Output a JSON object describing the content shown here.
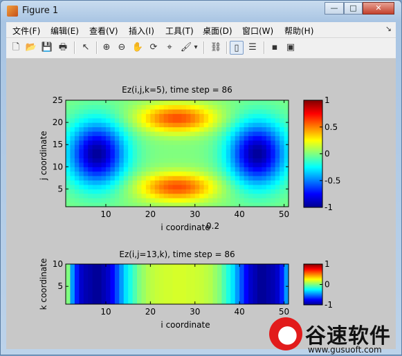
{
  "window": {
    "title": "Figure 1",
    "controls": {
      "minimize": "—",
      "maximize": "□",
      "close": "✕"
    }
  },
  "menu": {
    "items": [
      "文件(F)",
      "编辑(E)",
      "查看(V)",
      "插入(I)",
      "工具(T)",
      "桌面(D)",
      "窗口(W)",
      "帮助(H)"
    ],
    "overflow_arrow": "↘"
  },
  "toolbar": {
    "buttons": [
      {
        "name": "new-figure-icon",
        "glyph": "🗋"
      },
      {
        "name": "open-file-icon",
        "glyph": "📂"
      },
      {
        "name": "save-icon",
        "glyph": "💾"
      },
      {
        "name": "print-icon",
        "glyph": "🖶"
      },
      {
        "name": "select-arrow-icon",
        "glyph": "↖"
      },
      {
        "name": "zoom-in-icon",
        "glyph": "⊕"
      },
      {
        "name": "zoom-out-icon",
        "glyph": "⊖"
      },
      {
        "name": "pan-hand-icon",
        "glyph": "✋"
      },
      {
        "name": "rotate-3d-icon",
        "glyph": "⟳"
      },
      {
        "name": "data-cursor-icon",
        "glyph": "⌖"
      },
      {
        "name": "brush-icon",
        "glyph": "🖌"
      },
      {
        "name": "brush-dropdown-icon",
        "glyph": "▾"
      },
      {
        "name": "link-plot-icon",
        "glyph": "⛓"
      },
      {
        "name": "colorbar-icon",
        "glyph": "▯"
      },
      {
        "name": "legend-icon",
        "glyph": "☰"
      },
      {
        "name": "hide-plot-tools-icon",
        "glyph": "▪"
      },
      {
        "name": "show-plot-tools-icon",
        "glyph": "▣"
      }
    ]
  },
  "chart_data": [
    {
      "type": "heatmap",
      "title": "Ez(i,j,k=5), time step = 86",
      "xlabel": "i coordinate",
      "ylabel": "j coordinate",
      "xlim": [
        1,
        51
      ],
      "ylim": [
        1,
        25
      ],
      "xticks": [
        10,
        20,
        30,
        40,
        50
      ],
      "yticks": [
        5,
        10,
        15,
        20,
        25
      ],
      "colormap": "jet",
      "clim": [
        -1,
        1
      ],
      "colorbar_ticks": [
        {
          "value": 1,
          "label": "1"
        },
        {
          "value": 0.5,
          "label": "0.5"
        },
        {
          "value": 0,
          "label": "0"
        },
        {
          "value": -0.5,
          "label": "-0.5"
        },
        {
          "value": -1,
          "label": "-1"
        }
      ],
      "features": [
        {
          "kind": "negative-lobe",
          "center_i": 8,
          "center_j": 13,
          "min_value": -0.95
        },
        {
          "kind": "negative-lobe",
          "center_i": 44,
          "center_j": 13,
          "min_value": -0.95
        },
        {
          "kind": "positive-lobe",
          "center_i": 26,
          "center_j": 21,
          "max_value": 0.6
        },
        {
          "kind": "positive-lobe",
          "center_i": 26,
          "center_j": 5.5,
          "max_value": 0.6
        }
      ],
      "overlay_label": "0.2"
    },
    {
      "type": "heatmap",
      "title": "Ez(i,j=13,k), time step = 86",
      "xlabel": "i coordinate",
      "ylabel": "k coordinate",
      "xlim": [
        1,
        51
      ],
      "ylim": [
        1,
        10
      ],
      "xticks": [
        10,
        20,
        30,
        40,
        50
      ],
      "yticks": [
        5,
        10
      ],
      "colormap": "jet",
      "clim": [
        -1,
        1
      ],
      "colorbar_ticks": [
        {
          "value": 1,
          "label": "1"
        },
        {
          "value": 0,
          "label": "0"
        },
        {
          "value": -1,
          "label": "-1"
        }
      ],
      "profile_along_i": [
        0.0,
        -0.45,
        -0.7,
        -0.85,
        -0.9,
        -0.92,
        -0.95,
        -0.95,
        -0.9,
        -0.85,
        -0.75,
        -0.6,
        -0.45,
        -0.3,
        -0.2,
        -0.1,
        0.0,
        0.05,
        0.1,
        0.12,
        0.14,
        0.15,
        0.16,
        0.16,
        0.17,
        0.17,
        0.17,
        0.16,
        0.16,
        0.15,
        0.14,
        0.12,
        0.1,
        0.05,
        0.0,
        -0.1,
        -0.2,
        -0.3,
        -0.45,
        -0.6,
        -0.75,
        -0.85,
        -0.9,
        -0.95,
        -0.95,
        -0.92,
        -0.9,
        -0.85,
        -0.7,
        -0.45,
        0.0
      ]
    }
  ],
  "watermark": {
    "text": "谷速软件",
    "url": "www.gusuoft.com"
  }
}
